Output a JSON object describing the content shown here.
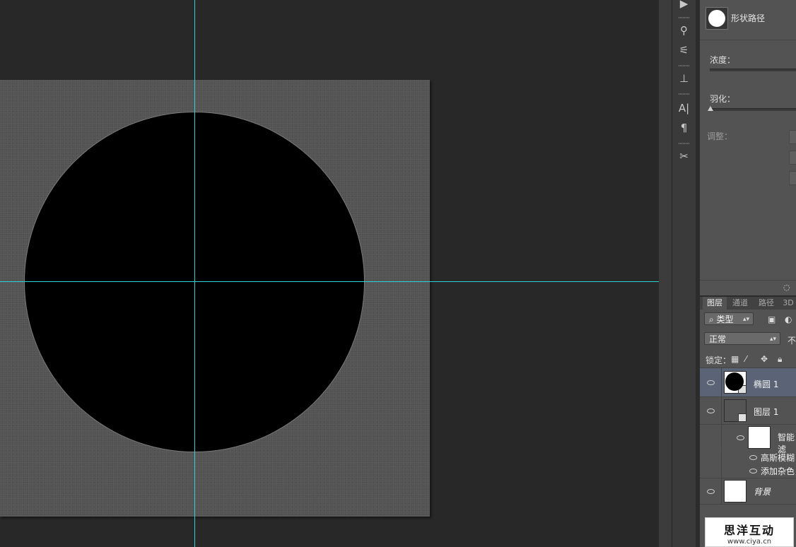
{
  "properties": {
    "title": "形状路径",
    "density_label": "浓度：",
    "feather_label": "羽化：",
    "adjust_label": "调整："
  },
  "layers_panel": {
    "tabs": [
      {
        "label": "图层",
        "active": true
      },
      {
        "label": "通道",
        "active": false
      },
      {
        "label": "路径",
        "active": false
      },
      {
        "label": "3D",
        "active": false
      }
    ],
    "filter_label": "类型",
    "blend_mode": "正常",
    "opacity_label_cut": "不",
    "lock_label": "锁定：",
    "layers": [
      {
        "name": "椭圆 1",
        "selected": true,
        "kind": "shape"
      },
      {
        "name": "图层 1",
        "selected": false,
        "kind": "smart-object"
      },
      {
        "name": "智能滤",
        "selected": false,
        "kind": "smart-filters"
      },
      {
        "name": "高斯模糊",
        "selected": false,
        "kind": "filter"
      },
      {
        "name": "添加杂色",
        "selected": false,
        "kind": "filter"
      },
      {
        "name": "背景",
        "selected": false,
        "kind": "background"
      }
    ]
  },
  "watermark": {
    "title": "思洋互动",
    "url": "www.ciya.cn"
  },
  "colors": {
    "guide": "#2fd0d6",
    "selected_layer": "#5b6477",
    "canvas": "#535353"
  }
}
